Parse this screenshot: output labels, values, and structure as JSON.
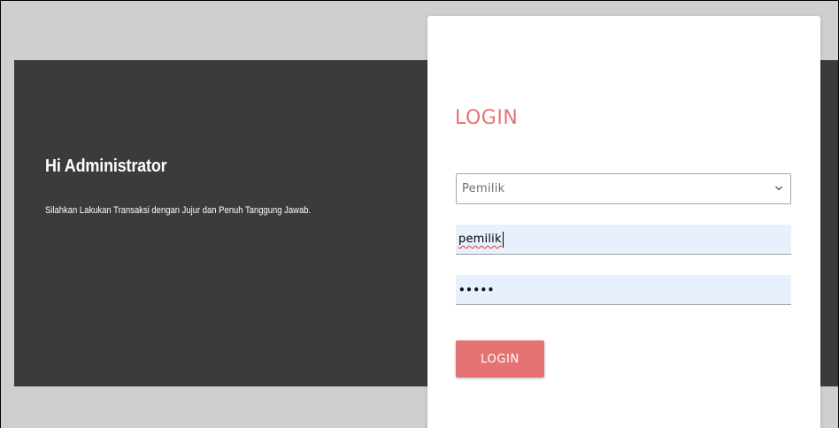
{
  "hero": {
    "greeting": "Hi Administrator",
    "message": "Silahkan Lakukan Transaksi dengan Jujur dan Penuh Tanggung Jawab."
  },
  "login_form": {
    "title": "LOGIN",
    "role_select": {
      "selected": "Pemilik",
      "icon": "chevron-down-icon"
    },
    "username": {
      "value": "pemilik"
    },
    "password": {
      "value": "•••••"
    },
    "submit_label": "LOGIN"
  },
  "colors": {
    "accent": "#e57373",
    "dark_panel": "#3b3b3b",
    "page_background": "#cfcfcf",
    "input_autofill": "#e8f0fe"
  }
}
